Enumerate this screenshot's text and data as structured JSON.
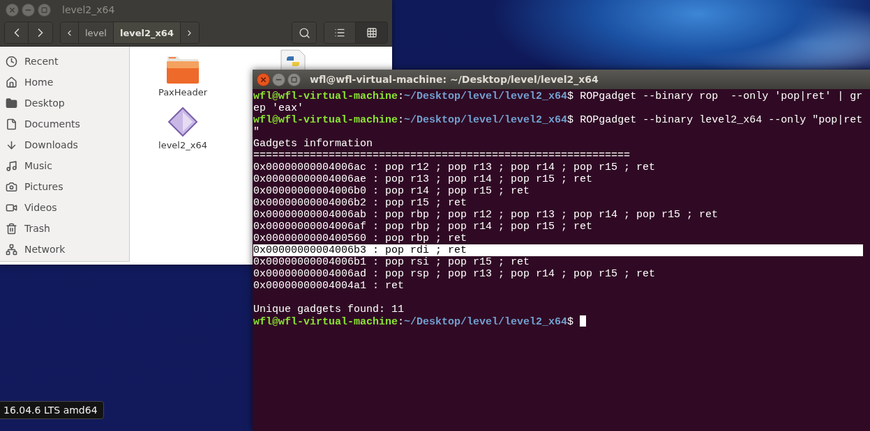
{
  "file_manager": {
    "title": "level2_x64",
    "path_bar": [
      {
        "label": "level",
        "selected": false
      },
      {
        "label": "level2_x64",
        "selected": true
      }
    ],
    "view_buttons": [
      {
        "kind": "list",
        "selected": false
      },
      {
        "kind": "grid",
        "selected": true
      }
    ],
    "sidebar": {
      "items": [
        {
          "kind": "recent",
          "label": "Recent"
        },
        {
          "kind": "home",
          "label": "Home"
        },
        {
          "kind": "desktop",
          "label": "Desktop"
        },
        {
          "kind": "documents",
          "label": "Documents"
        },
        {
          "kind": "downloads",
          "label": "Downloads"
        },
        {
          "kind": "music",
          "label": "Music"
        },
        {
          "kind": "pictures",
          "label": "Pictures"
        },
        {
          "kind": "videos",
          "label": "Videos"
        },
        {
          "kind": "trash",
          "label": "Trash"
        },
        {
          "kind": "network",
          "label": "Network"
        }
      ]
    },
    "files": [
      {
        "kind": "folder",
        "name": "PaxHeader"
      },
      {
        "kind": "executable",
        "name": "level2_x64"
      },
      {
        "kind": "python"
      }
    ]
  },
  "terminal": {
    "title": "wfl@wfl-virtual-machine: ~/Desktop/level/level2_x64",
    "lines": [
      {
        "kind": "prompt",
        "user": "wfl@wfl-virtual-machine",
        "sep": ":",
        "path": "~/Desktop/level/level2_x64",
        "symbol": "$",
        "command": " ROPgadget --binary rop  --only 'pop|ret' | gr",
        "cursor": false
      },
      {
        "kind": "output",
        "text": "ep 'eax'",
        "highlighted": false
      },
      {
        "kind": "prompt",
        "user": "wfl@wfl-virtual-machine",
        "sep": ":",
        "path": "~/Desktop/level/level2_x64",
        "symbol": "$",
        "command": " ROPgadget --binary level2_x64 --only \"pop|ret",
        "cursor": false
      },
      {
        "kind": "output",
        "text": "\"",
        "highlighted": false
      },
      {
        "kind": "output",
        "text": "Gadgets information",
        "highlighted": false
      },
      {
        "kind": "output",
        "text": "============================================================",
        "highlighted": false
      },
      {
        "kind": "output",
        "text": "0x00000000004006ac : pop r12 ; pop r13 ; pop r14 ; pop r15 ; ret",
        "highlighted": false
      },
      {
        "kind": "output",
        "text": "0x00000000004006ae : pop r13 ; pop r14 ; pop r15 ; ret",
        "highlighted": false
      },
      {
        "kind": "output",
        "text": "0x00000000004006b0 : pop r14 ; pop r15 ; ret",
        "highlighted": false
      },
      {
        "kind": "output",
        "text": "0x00000000004006b2 : pop r15 ; ret",
        "highlighted": false
      },
      {
        "kind": "output",
        "text": "0x00000000004006ab : pop rbp ; pop r12 ; pop r13 ; pop r14 ; pop r15 ; ret",
        "highlighted": false
      },
      {
        "kind": "output",
        "text": "0x00000000004006af : pop rbp ; pop r14 ; pop r15 ; ret",
        "highlighted": false
      },
      {
        "kind": "output",
        "text": "0x0000000000400560 : pop rbp ; ret",
        "highlighted": false
      },
      {
        "kind": "output",
        "text": "0x00000000004006b3 : pop rdi ; ret",
        "highlighted": true
      },
      {
        "kind": "output",
        "text": "0x00000000004006b1 : pop rsi ; pop r15 ; ret",
        "highlighted": false
      },
      {
        "kind": "output",
        "text": "0x00000000004006ad : pop rsp ; pop r13 ; pop r14 ; pop r15 ; ret",
        "highlighted": false
      },
      {
        "kind": "output",
        "text": "0x00000000004004a1 : ret",
        "highlighted": false
      },
      {
        "kind": "blank"
      },
      {
        "kind": "output",
        "text": "Unique gadgets found: 11",
        "highlighted": false
      },
      {
        "kind": "prompt",
        "user": "wfl@wfl-virtual-machine",
        "sep": ":",
        "path": "~/Desktop/level/level2_x64",
        "symbol": "$",
        "cursor": true
      }
    ]
  },
  "tooltip": {
    "text": "16.04.6 LTS amd64"
  }
}
